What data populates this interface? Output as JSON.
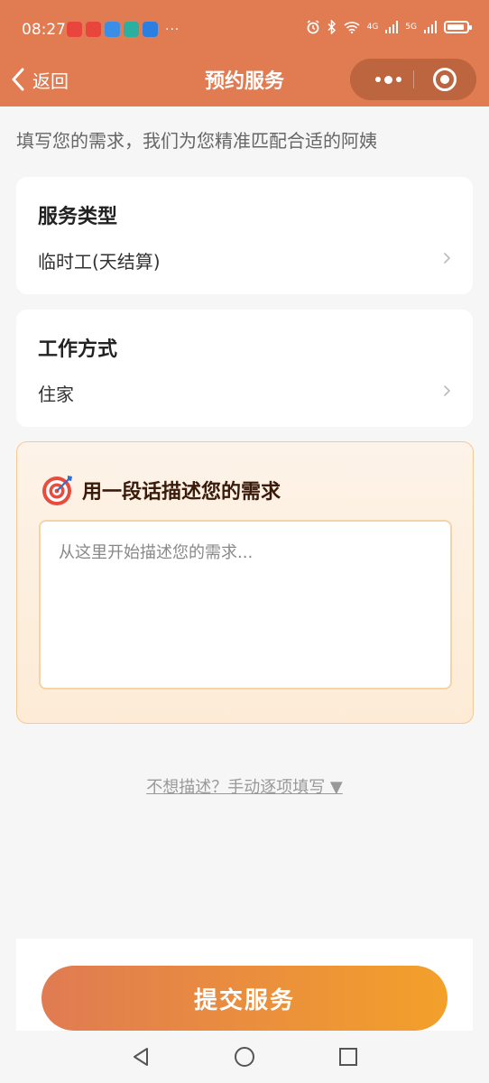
{
  "status_bar": {
    "time": "08:27",
    "more": "···",
    "signal_1": "4G",
    "signal_2": "5G",
    "battery_level": 0.9,
    "app_icon_colors": [
      "#e8453c",
      "#e8453c",
      "#3a8ee6",
      "#2bb0a0",
      "#2b7fe0"
    ]
  },
  "nav": {
    "back_label": "返回",
    "title": "预约服务"
  },
  "intro_text": "填写您的需求，我们为您精准匹配合适的阿姨",
  "cards": {
    "service_type": {
      "title": "服务类型",
      "value": "临时工(天结算)"
    },
    "work_mode": {
      "title": "工作方式",
      "value": "住家"
    }
  },
  "describe": {
    "title": "用一段话描述您的需求",
    "placeholder": "从这里开始描述您的需求..."
  },
  "manual_link": "不想描述？手动逐项填写 ▼",
  "submit_label": "提交服务",
  "colors": {
    "header": "#e07b52",
    "accent_start": "#e07b52",
    "accent_end": "#f3a02a"
  }
}
